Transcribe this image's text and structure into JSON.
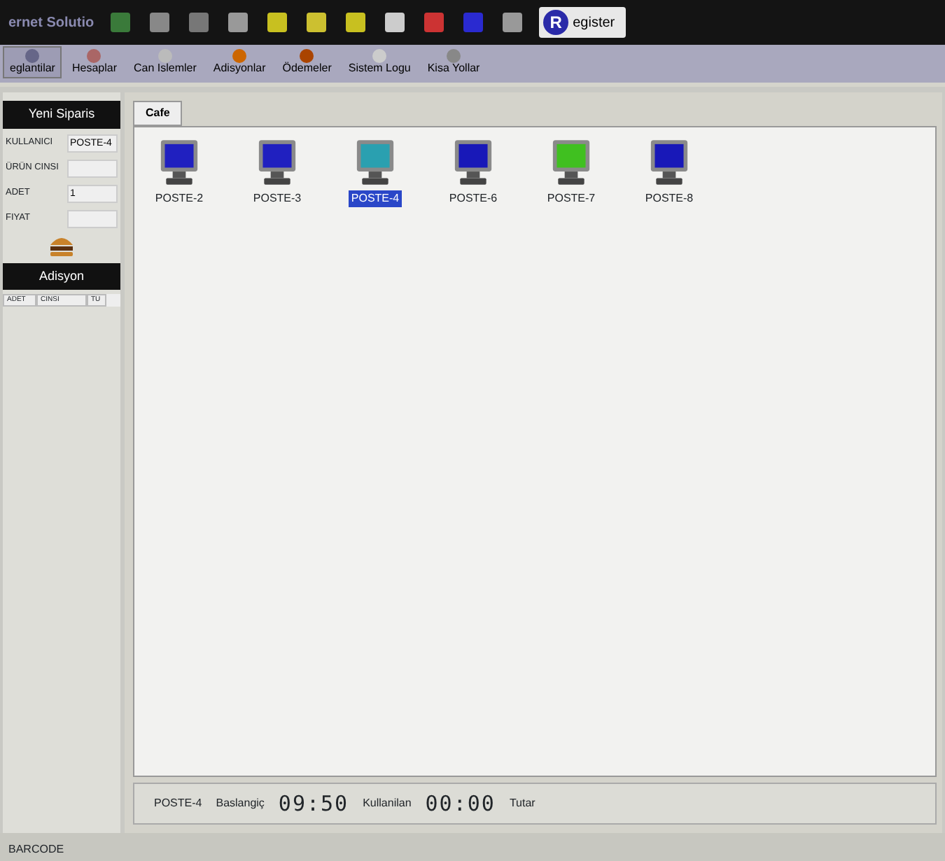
{
  "header": {
    "logo_text": "ernet Solutio",
    "register_button": {
      "letter": "R",
      "label": "egister"
    }
  },
  "toolbar": [
    {
      "label": "eglantilar",
      "selected": true
    },
    {
      "label": "Hesaplar",
      "selected": false
    },
    {
      "label": "Can Islemler",
      "selected": false
    },
    {
      "label": "Adisyonlar",
      "selected": false
    },
    {
      "label": "Ödemeler",
      "selected": false
    },
    {
      "label": "Sistem Logu",
      "selected": false
    },
    {
      "label": "Kisa Yollar",
      "selected": false
    }
  ],
  "order_panel": {
    "title": "Yeni Siparis",
    "fields": [
      {
        "label": "KULLANICI",
        "value": "POSTE-4"
      },
      {
        "label": "ÜRÜN CINSI"
      },
      {
        "label": "ADET",
        "value": "1"
      },
      {
        "label": "FIYAT"
      }
    ]
  },
  "adisyon": {
    "title": "Adisyon",
    "columns": [
      "ADET",
      "CINSI",
      "TU"
    ]
  },
  "tabs": [
    {
      "label": "Cafe",
      "selected": true
    }
  ],
  "stations": [
    {
      "name": "POSTE-2",
      "color": "#2020c0",
      "selected": false
    },
    {
      "name": "POSTE-3",
      "color": "#2020c0",
      "selected": false
    },
    {
      "name": "POSTE-4",
      "color": "#2aa0b0",
      "selected": true
    },
    {
      "name": "POSTE-6",
      "color": "#1818b8",
      "selected": false
    },
    {
      "name": "POSTE-7",
      "color": "#40c020",
      "selected": false
    },
    {
      "name": "POSTE-8",
      "color": "#1818b8",
      "selected": false
    }
  ],
  "status_bar": {
    "station": "POSTE-4",
    "start_label": "Baslangiç",
    "start_time": "09:50",
    "used_label": "Kullanilan",
    "used_time": "00:00",
    "total_label": "Tutar"
  },
  "footer": {
    "text": "BARCODE"
  }
}
